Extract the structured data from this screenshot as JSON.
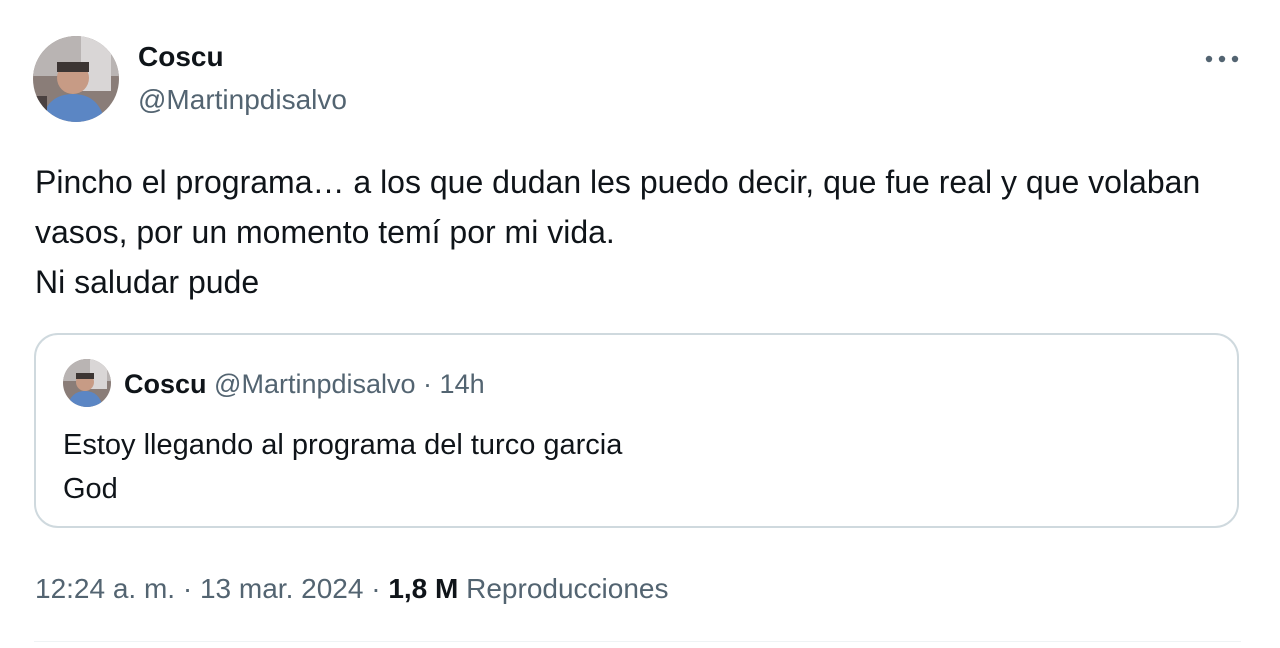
{
  "author": {
    "display_name": "Coscu",
    "handle": "@Martinpdisalvo"
  },
  "tweet": {
    "text": "Pincho el programa… a los que dudan les puedo decir, que fue real y que volaban vasos, por un momento temí por mi vida.\nNi saludar pude"
  },
  "quote": {
    "display_name": "Coscu",
    "handle": "@Martinpdisalvo",
    "separator": " · ",
    "time": "14h",
    "text": "Estoy llegando al programa del turco garcia\nGod"
  },
  "meta": {
    "time": "12:24 a. m.",
    "separator": " · ",
    "date": "13 mar. 2024",
    "views_count": "1,8 M",
    "views_label": "Reproducciones"
  },
  "icons": {
    "more": "more-horizontal-icon"
  },
  "colors": {
    "text_primary": "#0f1419",
    "text_secondary": "#536471",
    "border": "#cfd9de"
  }
}
